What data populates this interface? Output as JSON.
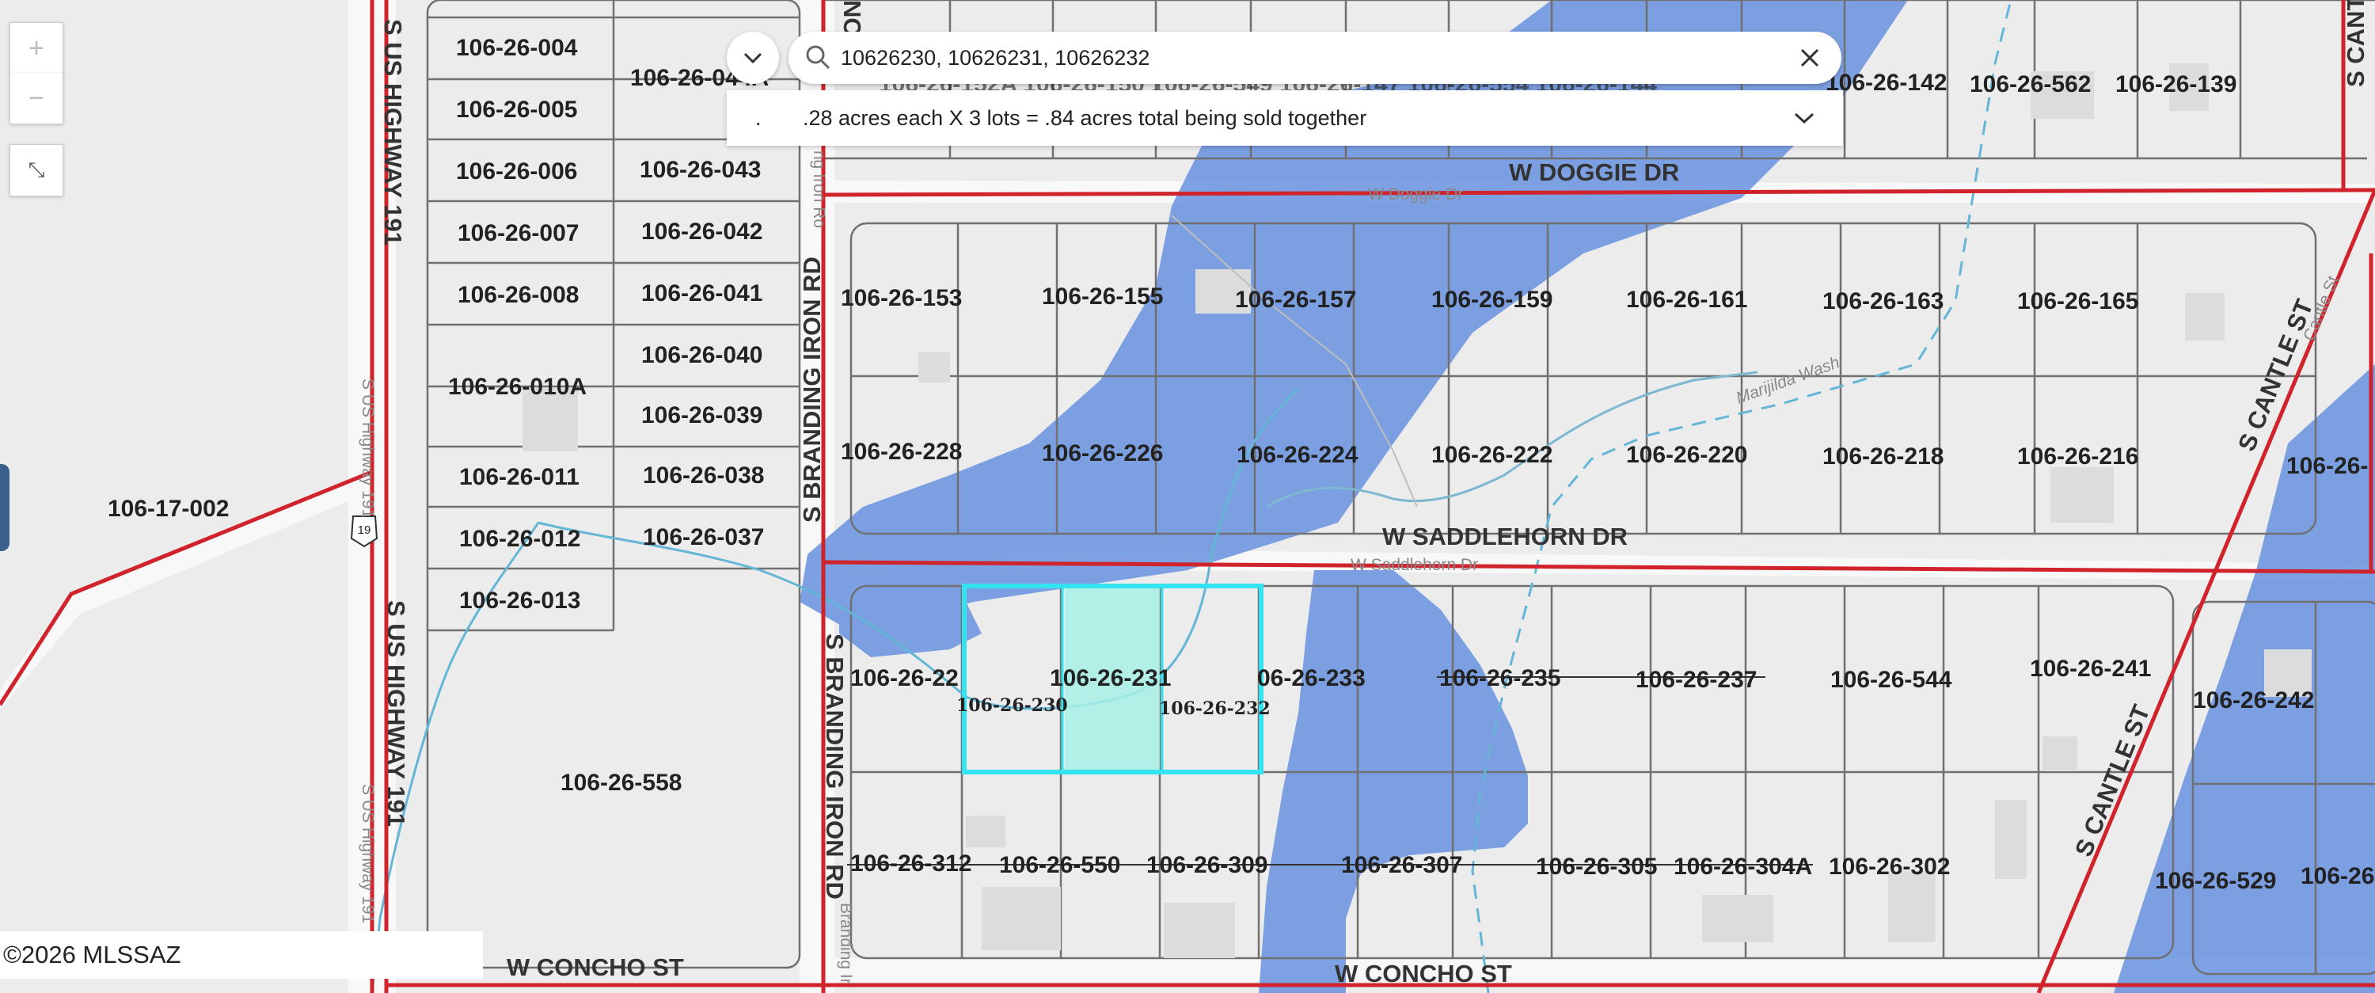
{
  "search": {
    "query": "10626230, 10626231, 10626232",
    "description": ".28 acres each X 3 lots = .84 acres total being sold together",
    "description_prefix": "."
  },
  "attribution": "©2026 MLSSAZ",
  "roads": {
    "us191_a": "S US HIGHWAY 191",
    "us191_b": "S US HIGHWAY 191",
    "us191_minor_a": "S US Highway 191",
    "us191_minor_b": "S US Highway 191",
    "shield": "19",
    "branding_iron_a": "S BRANDING IRON RD",
    "branding_iron_b": "S BRANDING IRON RD",
    "branding_iron_minor_a": "ng Iron Ro",
    "branding_iron_minor_b": "Branding Ir",
    "doggie": "W DOGGIE DR",
    "doggie_minor": "W Doggie Dr",
    "saddlehorn": "W SADDLEHORN DR",
    "saddlehorn_minor": "W Saddlehorn Dr",
    "concho_a": "W CONCHO ST",
    "concho_b": "W CONCHO ST",
    "cantle_a": "S CANTLE ST",
    "cantle_b": "S CANTLE ST",
    "cantle_c": "S CANT",
    "cantle_minor": "Cantle St",
    "wash": "Marijilda Wash",
    "top_fragment": "NC"
  },
  "parcels": {
    "p004": "106-26-004",
    "p044": "106-26-044A",
    "p005": "106-26-005",
    "p006": "106-26-006",
    "p043": "106-26-043",
    "p007": "106-26-007",
    "p042": "106-26-042",
    "p008": "106-26-008",
    "p041": "106-26-041",
    "p040": "106-26-040",
    "p010a": "106-26-010A",
    "p039": "106-26-039",
    "p011": "106-26-011",
    "p038": "106-26-038",
    "p012": "106-26-012",
    "p037": "106-26-037",
    "p013": "106-26-013",
    "p558": "106-26-558",
    "p17002": "106-17-002",
    "p142": "106-26-142",
    "p562": "106-26-562",
    "p139": "106-26-139",
    "p153": "106-26-153",
    "p155": "106-26-155",
    "p157": "106-26-157",
    "p159": "106-26-159",
    "p161": "106-26-161",
    "p163": "106-26-163",
    "p165": "106-26-165",
    "p228": "106-26-228",
    "p226": "106-26-226",
    "p224": "106-26-224",
    "p222": "106-26-222",
    "p220": "106-26-220",
    "p218": "106-26-218",
    "p216": "106-26-216",
    "p_right_edge": "106-26-",
    "p22x": "106-26-22",
    "p231": "106-26-231",
    "p230": "106-26-230",
    "p232": "106-26-232",
    "p233": "06-26-233",
    "p235": "106-26-235",
    "p237": "106-26-237",
    "p544": "106-26-544",
    "p241": "106-26-241",
    "p242": "106-26-242",
    "p312": "106-26-312",
    "p550": "106-26-550",
    "p309": "106-26-309",
    "p307": "106-26-307",
    "p305": "106-26-305",
    "p304a": "106-26-304A",
    "p302": "106-26-302",
    "p529": "106-26-529",
    "p52x": "106-26",
    "top_row": "106-26-152A   106-26-150   106-26-549   106-26-147   106-26-554   106-26-144"
  },
  "colors": {
    "background": "#ececec",
    "floodplain": "#6f97e0",
    "parcel_line": "#707070",
    "boundary_red": "#d0232b",
    "selection_outline": "#33e3ef",
    "selection_fill": "#a7f0e6",
    "wash_line": "#63b6d6"
  },
  "icons": {
    "zoom_in": "plus-icon",
    "zoom_out": "minus-icon",
    "expand": "expand-icon",
    "toggle": "chevron-down-icon",
    "search": "search-icon",
    "clear": "close-icon",
    "expand_desc": "chevron-down-icon"
  }
}
